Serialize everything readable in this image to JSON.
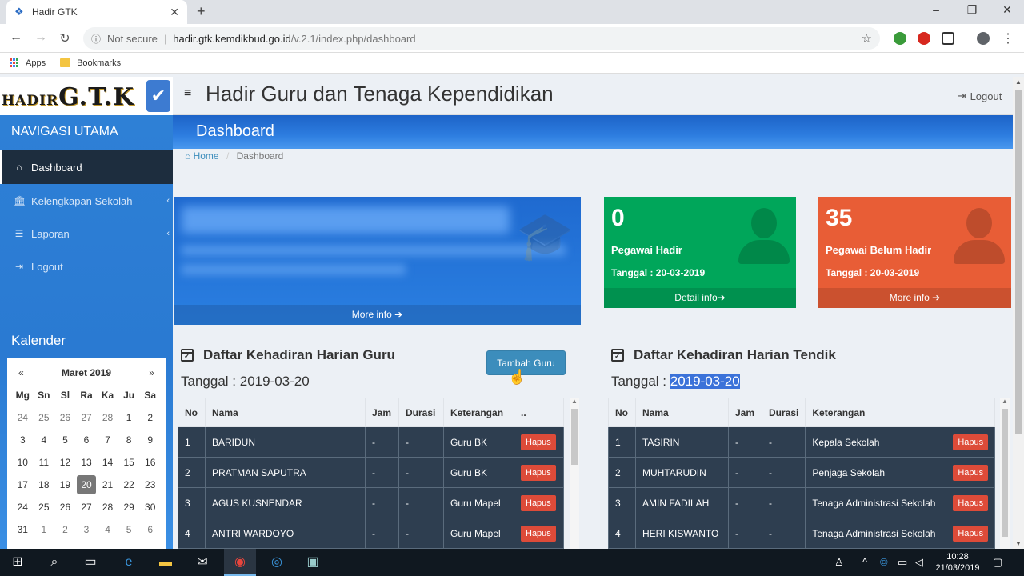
{
  "browser": {
    "tab_title": "Hadir GTK",
    "url_security": "Not secure",
    "url_host": "hadir.gtk.kemdikbud.go.id",
    "url_path": "/v.2.1/index.php/dashboard",
    "bookmarks": [
      {
        "label": "Apps"
      },
      {
        "label": "Bookmarks"
      }
    ]
  },
  "app": {
    "logo_text_small": "HADIR",
    "logo_text_big": "G.T.K",
    "title": "Hadir Guru dan Tenaga Kependidikan",
    "logout_label": "Logout"
  },
  "sidebar": {
    "header": "NAVIGASI UTAMA",
    "items": [
      {
        "label": "Dashboard",
        "icon": "home-icon"
      },
      {
        "label": "Kelengkapan Sekolah",
        "icon": "institution-icon"
      },
      {
        "label": "Laporan",
        "icon": "list-icon"
      },
      {
        "label": "Logout",
        "icon": "sign-out-icon"
      }
    ],
    "calendar_header": "Kalender"
  },
  "calendar": {
    "prev": "«",
    "month": "Maret 2019",
    "next": "»",
    "days": [
      "Mg",
      "Sn",
      "Sl",
      "Ra",
      "Ka",
      "Ju",
      "Sa"
    ],
    "weeks": [
      [
        "24",
        "25",
        "26",
        "27",
        "28",
        "1",
        "2"
      ],
      [
        "3",
        "4",
        "5",
        "6",
        "7",
        "8",
        "9"
      ],
      [
        "10",
        "11",
        "12",
        "13",
        "14",
        "15",
        "16"
      ],
      [
        "17",
        "18",
        "19",
        "20",
        "21",
        "22",
        "23"
      ],
      [
        "24",
        "25",
        "26",
        "27",
        "28",
        "29",
        "30"
      ],
      [
        "31",
        "1",
        "2",
        "3",
        "4",
        "5",
        "6"
      ]
    ],
    "selected": "20"
  },
  "content": {
    "title": "Dashboard",
    "breadcrumb_home": "Home",
    "breadcrumb_current": "Dashboard",
    "school_more": "More info"
  },
  "stats": [
    {
      "value": "0",
      "label": "Pegawai Hadir",
      "date": "Tanggal : 20-03-2019",
      "link": "Detail info",
      "color": "#00a65a"
    },
    {
      "value": "35",
      "label": "Pegawai Belum Hadir",
      "date": "Tanggal : 20-03-2019",
      "link": "More info",
      "color": "#e85d36"
    }
  ],
  "guru": {
    "title": "Daftar Kehadiran Harian Guru",
    "tanggal_label": "Tanggal : ",
    "tanggal_value": "2019-03-20",
    "add_button": "Tambah Guru",
    "columns": [
      "No",
      "Nama",
      "Jam",
      "Durasi",
      "Keterangan",
      ".."
    ],
    "rows": [
      {
        "no": "1",
        "nama": "BARIDUN",
        "jam": "-",
        "durasi": "-",
        "ket": "Guru BK",
        "aksi": "Hapus"
      },
      {
        "no": "2",
        "nama": "PRATMAN SAPUTRA",
        "jam": "-",
        "durasi": "-",
        "ket": "Guru BK",
        "aksi": "Hapus"
      },
      {
        "no": "3",
        "nama": "AGUS KUSNENDAR",
        "jam": "-",
        "durasi": "-",
        "ket": "Guru Mapel",
        "aksi": "Hapus"
      },
      {
        "no": "4",
        "nama": "ANTRI WARDOYO",
        "jam": "-",
        "durasi": "-",
        "ket": "Guru Mapel",
        "aksi": "Hapus"
      }
    ]
  },
  "tendik": {
    "title": "Daftar Kehadiran Harian Tendik",
    "tanggal_label": "Tanggal : ",
    "tanggal_value": "2019-03-20",
    "columns": [
      "No",
      "Nama",
      "Jam",
      "Durasi",
      "Keterangan",
      ""
    ],
    "rows": [
      {
        "no": "1",
        "nama": "TASIRIN",
        "jam": "-",
        "durasi": "-",
        "ket": "Kepala Sekolah",
        "aksi": "Hapus"
      },
      {
        "no": "2",
        "nama": "MUHTARUDIN",
        "jam": "-",
        "durasi": "-",
        "ket": "Penjaga Sekolah",
        "aksi": "Hapus"
      },
      {
        "no": "3",
        "nama": "AMIN FADILAH",
        "jam": "-",
        "durasi": "-",
        "ket": "Tenaga Administrasi Sekolah",
        "aksi": "Hapus"
      },
      {
        "no": "4",
        "nama": "HERI KISWANTO",
        "jam": "-",
        "durasi": "-",
        "ket": "Tenaga Administrasi Sekolah",
        "aksi": "Hapus"
      }
    ]
  },
  "taskbar": {
    "time": "10:28",
    "date": "21/03/2019"
  }
}
